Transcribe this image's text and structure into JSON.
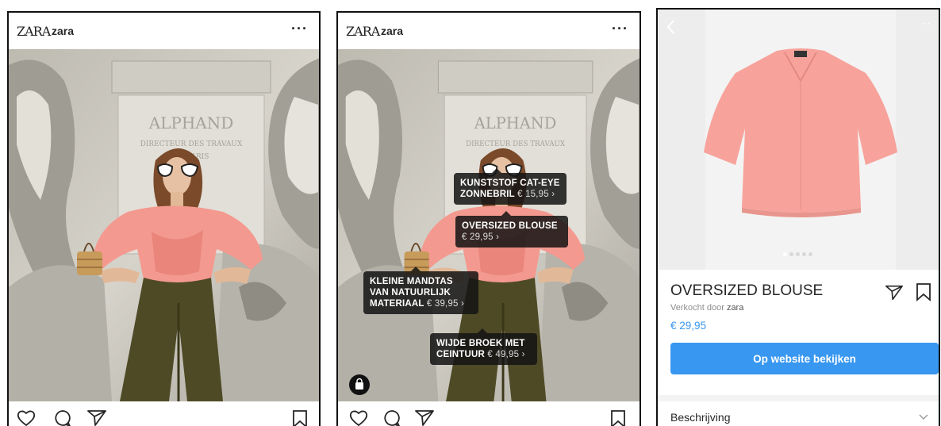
{
  "post": {
    "brand_logo": "ZARA",
    "username": "zara",
    "more_label": "···"
  },
  "tags": [
    {
      "name": "KUNSTSTOF CAT-EYE ZONNEBRIL",
      "price": "€ 15,95 ›"
    },
    {
      "name": "OVERSIZED BLOUSE",
      "price": "€ 29,95 ›"
    },
    {
      "name": "KLEINE MANDTAS VAN NATUURLIJK MATERIAAL",
      "price": "€ 39,95 ›"
    },
    {
      "name": "WIJDE BROEK MET CEINTUUR",
      "price": "€ 49,95 ›"
    }
  ],
  "statue_inscription": {
    "line1": "ALPHAND",
    "line2": "DIRECTEUR DES TRAVAUX",
    "line3": "DE PARIS"
  },
  "product": {
    "title": "OVERSIZED BLOUSE",
    "seller_prefix": "Verkocht door",
    "seller": "zara",
    "price": "€ 29,95",
    "cta": "Op website bekijken",
    "description_label": "Beschrijving",
    "image_count": 5,
    "active_image": 1
  },
  "icons": [
    "heart-icon",
    "comment-icon",
    "share-icon",
    "bookmark-icon",
    "shopping-bag-icon",
    "back-icon",
    "chevron-down-icon"
  ],
  "colors": {
    "accent": "#3897f0",
    "tag_bg": "#141414",
    "blouse": "#f4998f",
    "trousers": "#4e4a26"
  }
}
